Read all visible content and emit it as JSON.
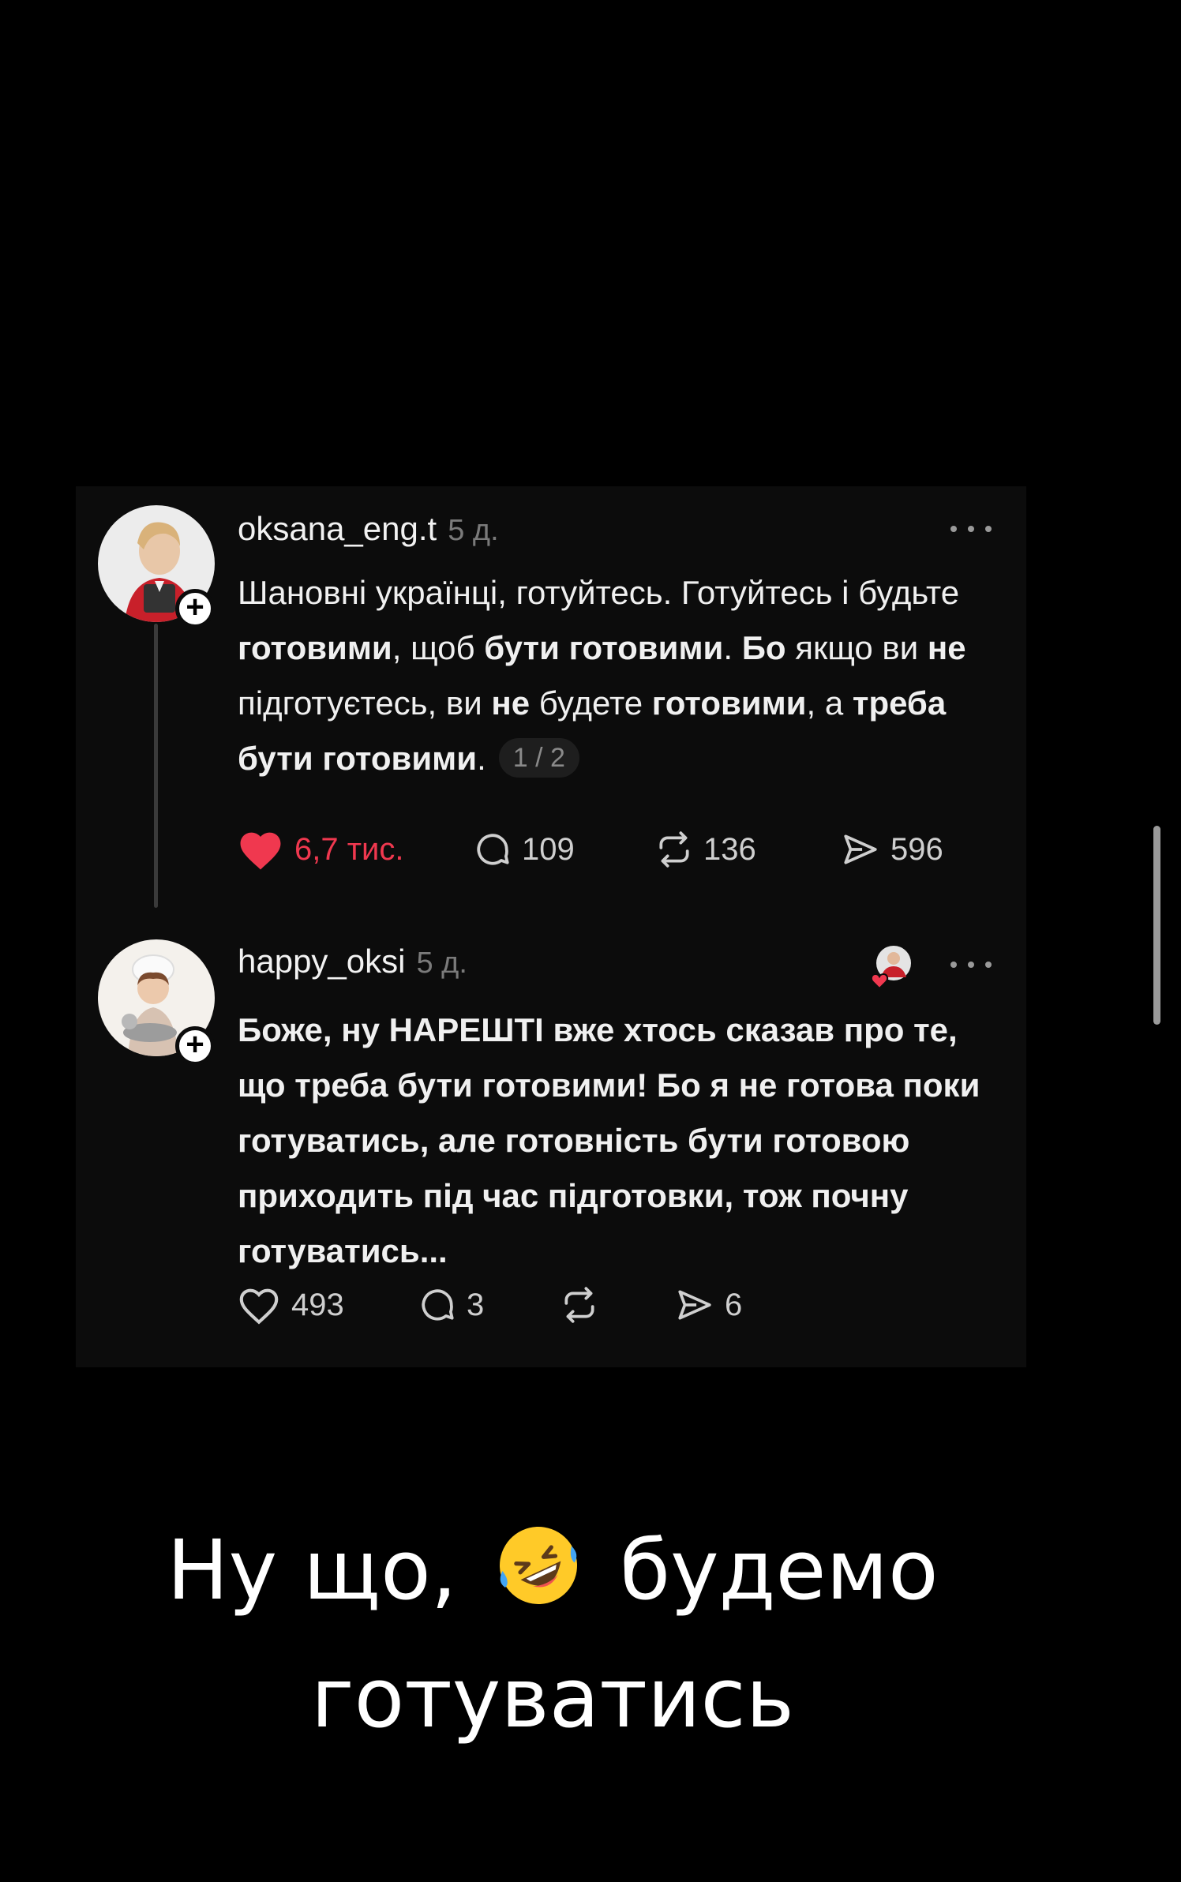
{
  "posts": [
    {
      "username": "oksana_eng.t",
      "time": "5 д.",
      "text_html": "Шановні українці, готуйтесь. Готуйтесь і будьте <b>готовими</b>, щоб <b>бути готовими</b>. <b>Бо</b> якщо ви <b>не</b> підготуєтесь, ви <b>не</b> будете <b>готовими</b>, а <b>треба бути готовими</b>.",
      "page_indicator": "1 / 2",
      "likes": "6,7 тис.",
      "liked": true,
      "replies": "109",
      "reposts": "136",
      "shares": "596"
    },
    {
      "username": "happy_oksi",
      "time": "5 д.",
      "text": "Боже, ну НАРЕШТІ вже хтось сказав про те, що треба бути готовими! Бо я не готова поки готуватись, але готовність бути готовою приходить під час підготовки, тож почну готуватись...",
      "likes": "493",
      "liked": false,
      "replies": "3",
      "reposts": "",
      "shares": "6"
    }
  ],
  "caption": {
    "line1_before": "Ну що,",
    "emoji": "rolling-on-floor-laughing",
    "line1_after": "будемо",
    "line2": "готуватись"
  },
  "colors": {
    "background": "#000000",
    "card": "#0c0c0c",
    "like_red": "#f0384f",
    "muted": "#7a7a7a"
  }
}
